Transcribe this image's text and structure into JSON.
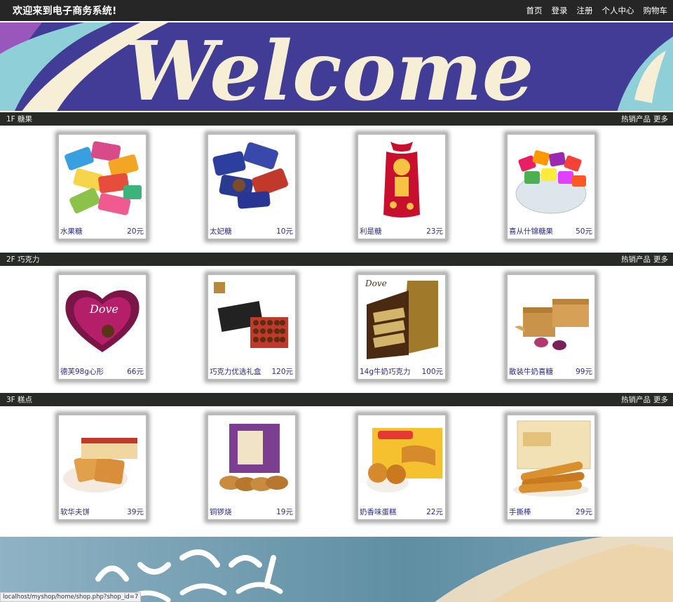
{
  "header": {
    "title": "欢迎来到电子商务系统!",
    "nav": [
      "首页",
      "登录",
      "注册",
      "个人中心",
      "购物车"
    ]
  },
  "banner": {
    "text": "Welcome"
  },
  "floors": [
    {
      "label": "1F 糖果",
      "hot_label": "热销产品",
      "more_label": "更多",
      "products": [
        {
          "name": "水果糖",
          "price": "20元",
          "icon": "fruit-candy-image"
        },
        {
          "name": "太妃糖",
          "price": "10元",
          "icon": "toffee-image"
        },
        {
          "name": "利是糖",
          "price": "23元",
          "icon": "lucky-candy-bag-image"
        },
        {
          "name": "喜从什锦糖果",
          "price": "50元",
          "icon": "mixed-candy-bowl-image"
        }
      ]
    },
    {
      "label": "2F 巧克力",
      "hot_label": "热销产品",
      "more_label": "更多",
      "products": [
        {
          "name": "德芙98g心形",
          "price": "66元",
          "icon": "heart-chocolate-box-image"
        },
        {
          "name": "巧克力优选礼盒",
          "price": "120元",
          "icon": "chocolate-gift-box-image"
        },
        {
          "name": "14g牛奶巧克力",
          "price": "100元",
          "icon": "milk-chocolate-display-box-image"
        },
        {
          "name": "散装牛奶喜糖",
          "price": "99元",
          "icon": "wrapped-chocolate-gift-image"
        }
      ]
    },
    {
      "label": "3F 糕点",
      "hot_label": "热销产品",
      "more_label": "更多",
      "products": [
        {
          "name": "软华夫饼",
          "price": "39元",
          "icon": "waffle-image"
        },
        {
          "name": "铜锣烧",
          "price": "19元",
          "icon": "dorayaki-image"
        },
        {
          "name": "奶香味蛋糕",
          "price": "22元",
          "icon": "milk-cake-image"
        },
        {
          "name": "手撕棒",
          "price": "29元",
          "icon": "bread-stick-image"
        }
      ]
    }
  ],
  "status_url": "localhost/myshop/home/shop.php?shop_id=7",
  "colors": {
    "header_bg": "#262626",
    "banner_bg": "#3f3b95",
    "floor_bar": "#282a26",
    "link": "#2a2a8a"
  }
}
